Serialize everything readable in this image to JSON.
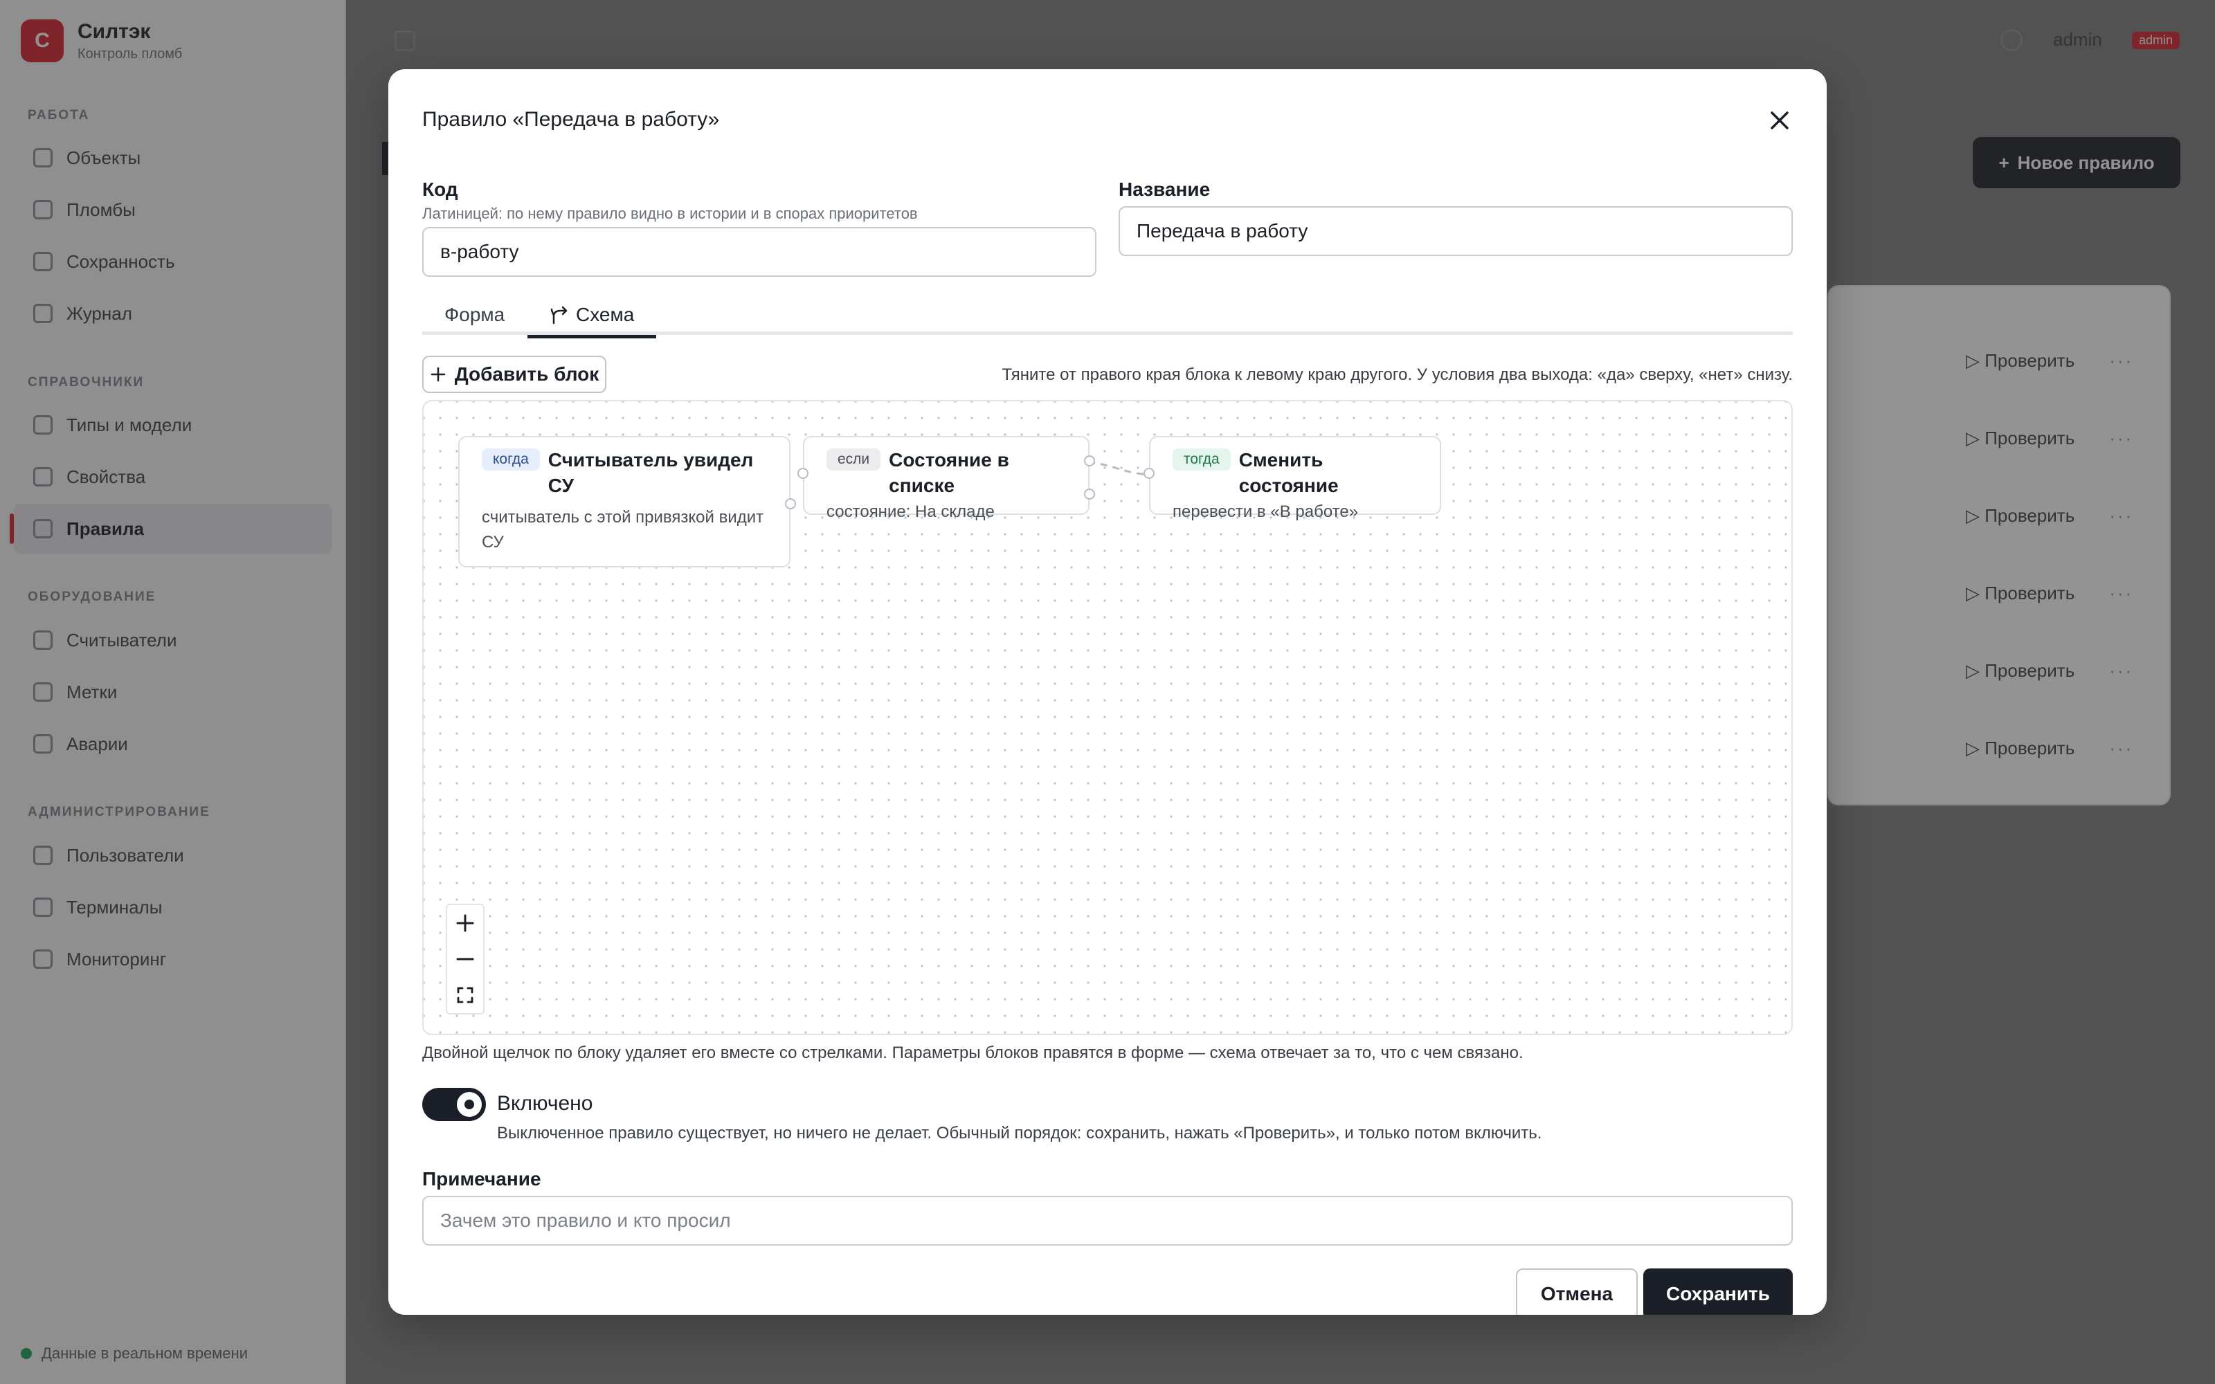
{
  "app": {
    "brand_initial": "С",
    "brand_name": "Силтэк",
    "brand_sub": "Контроль пломб",
    "sections": [
      "Работа",
      "Справочники",
      "Оборудование",
      "Администрирование"
    ],
    "nav": [
      "Объекты",
      "Пломбы",
      "Сохранность",
      "Журнал",
      "Типы и модели",
      "Свойства",
      "Правила",
      "Считыватели",
      "Метки",
      "Аварии",
      "Пользователи",
      "Терминалы",
      "Мониторинг"
    ],
    "footer_status": "Данные в реальном времени",
    "user_name": "admin",
    "user_role": "admin",
    "new_rule_label": "Новое правило",
    "row_check_label": "Проверить",
    "row_more": "···",
    "colors": {
      "accent": "#d8202f",
      "primary": "#1b1f27"
    }
  },
  "modal": {
    "title": "Правило «Передача в работу»",
    "code": {
      "label": "Код",
      "hint": "Латиницей: по нему правило видно в истории и в спорах приоритетов",
      "value": "в-работу"
    },
    "name": {
      "label": "Название",
      "value": "Передача в работу"
    },
    "tabs": [
      {
        "label": "Форма",
        "active": false
      },
      {
        "label": "Схема",
        "active": true
      }
    ],
    "add_block_label": "Добавить блок",
    "canvas_hint": "Тяните от правого края блока к левому краю другого. У условия два выхода: «да» сверху, «нет» снизу.",
    "nodes": [
      {
        "badge": "когда",
        "title": "Считыватель увидел СУ",
        "desc": "считыватель с этой привязкой видит СУ"
      },
      {
        "badge": "если",
        "title": "Состояние в списке",
        "desc": "состояние: На складе"
      },
      {
        "badge": "тогда",
        "title": "Сменить состояние",
        "desc": "перевести в «В работе»"
      }
    ],
    "schema_note": "Двойной щелчок по блоку удаляет его вместе со стрелками. Параметры блоков правятся в форме — схема отвечает за то, что с чем связано.",
    "enabled": {
      "label": "Включено",
      "hint": "Выключенное правило существует, но ничего не делает. Обычный порядок: сохранить, нажать «Проверить», и только потом включить.",
      "on": true
    },
    "note": {
      "label": "Примечание",
      "placeholder": "Зачем это правило и кто просил",
      "value": ""
    },
    "cancel_label": "Отмена",
    "save_label": "Сохранить"
  }
}
